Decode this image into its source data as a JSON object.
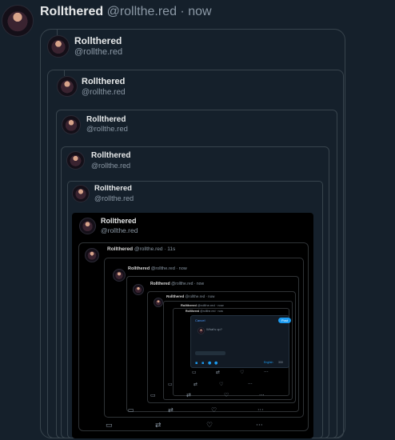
{
  "tweet": {
    "display_name": "Rollthered",
    "handle": "@rollthe.red",
    "separator": "·",
    "time": "now"
  },
  "nested": [
    {
      "name": "Rollthered",
      "handle": "@rollthe.red"
    },
    {
      "name": "Rollthered",
      "handle": "@rollthe.red"
    },
    {
      "name": "Rollthered",
      "handle": "@rollthe.red"
    },
    {
      "name": "Rollthered",
      "handle": "@rollthe.red"
    },
    {
      "name": "Rollthered",
      "handle": "@rollthe.red"
    },
    {
      "name": "Rollthered",
      "handle": "@rollthe.red"
    }
  ],
  "deep": {
    "row1": {
      "name": "Rollthered",
      "meta": "@rollthe.red · 11s"
    },
    "row2": {
      "name": "Rollthered",
      "meta": "@rollthe.red · now"
    },
    "row3": {
      "name": "Rollthered",
      "meta": "@rollthe.red · now"
    },
    "row4": {
      "name": "Rollthered",
      "meta": "@rollthe.red · now"
    },
    "row5": {
      "name": "Rollthered",
      "meta": "@rollthe.red · now"
    },
    "row6": {
      "name": "Rollthered",
      "meta": "@rollthe.red · now"
    },
    "composer": {
      "cancel": "Cancel",
      "post": "Post",
      "placeholder": "What's up?",
      "lang": "English",
      "count": "300"
    }
  },
  "actions": {
    "reply_icon": "reply-icon",
    "repost_icon": "repost-icon",
    "like_icon": "like-icon",
    "more_icon": "more-icon"
  }
}
